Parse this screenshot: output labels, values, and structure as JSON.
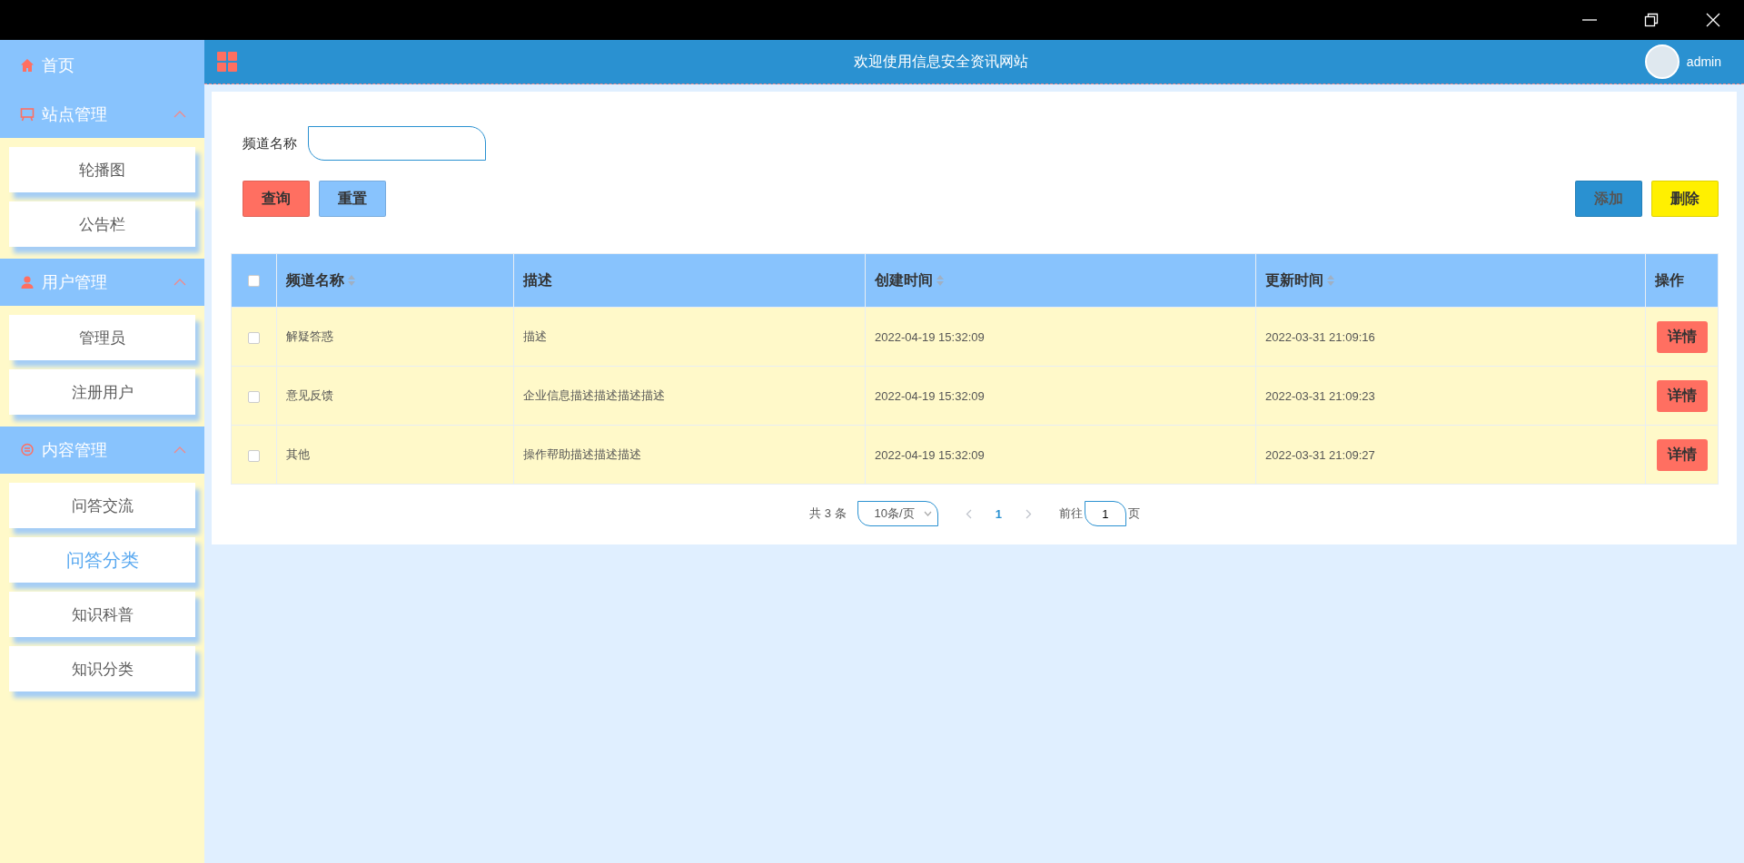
{
  "sidebar": {
    "items": [
      {
        "kind": "link",
        "label": "首页"
      },
      {
        "kind": "group",
        "label": "站点管理",
        "expanded": true,
        "children": [
          {
            "label": "轮播图",
            "selected": false
          },
          {
            "label": "公告栏",
            "selected": false
          }
        ]
      },
      {
        "kind": "group",
        "label": "用户管理",
        "expanded": true,
        "children": [
          {
            "label": "管理员",
            "selected": false
          },
          {
            "label": "注册用户",
            "selected": false
          }
        ]
      },
      {
        "kind": "group",
        "label": "内容管理",
        "expanded": true,
        "children": [
          {
            "label": "问答交流",
            "selected": false
          },
          {
            "label": "问答分类",
            "selected": true
          },
          {
            "label": "知识科普",
            "selected": false
          },
          {
            "label": "知识分类",
            "selected": false
          }
        ]
      }
    ]
  },
  "header": {
    "title": "欢迎使用信息安全资讯网站",
    "user": "admin"
  },
  "search": {
    "fields": [
      {
        "label": "频道名称"
      }
    ],
    "buttons": [
      {
        "label": "查询",
        "kind": "danger"
      },
      {
        "label": "重置",
        "kind": "info"
      }
    ],
    "actions": [
      {
        "label": "添加",
        "kind": "primary"
      },
      {
        "label": "删除",
        "kind": "warning"
      }
    ]
  },
  "table": {
    "all_checked": false,
    "columns": [
      {
        "label": "频道名称",
        "sortable": true
      },
      {
        "label": "描述",
        "sortable": false
      },
      {
        "label": "创建时间",
        "sortable": true
      },
      {
        "label": "更新时间",
        "sortable": true
      },
      {
        "label": "操作",
        "sortable": false
      }
    ],
    "rows": [
      {
        "checked": false,
        "cells": [
          "解疑答惑",
          "描述",
          "2022-04-19 15:32:09",
          "2022-03-31 21:09:16"
        ],
        "action": "详情"
      },
      {
        "checked": false,
        "cells": [
          "意见反馈",
          "企业信息描述描述描述描述",
          "2022-04-19 15:32:09",
          "2022-03-31 21:09:23"
        ],
        "action": "详情"
      },
      {
        "checked": false,
        "cells": [
          "其他",
          "操作帮助描述描述描述",
          "2022-04-19 15:32:09",
          "2022-03-31 21:09:27"
        ],
        "action": "详情"
      }
    ]
  },
  "pagination": {
    "total": "共 3 条",
    "page_size": "10条/页",
    "prev_disabled": true,
    "pages": [
      {
        "label": "1",
        "selected": true
      }
    ],
    "next_disabled": true,
    "goto_label": "前往",
    "goto_value": "1",
    "goto_suffix": "页"
  }
}
